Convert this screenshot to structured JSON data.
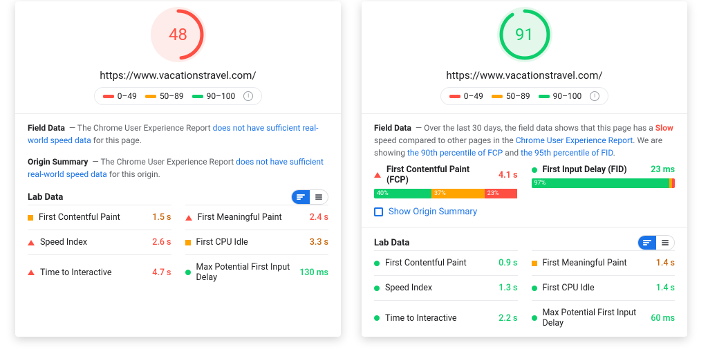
{
  "legend": {
    "r": "0–49",
    "o": "50–89",
    "g": "90–100"
  },
  "colors": {
    "red": "#ff4e42",
    "orange": "#ffa400",
    "green": "#0cce6b",
    "blue": "#1a73e8"
  },
  "left": {
    "score": 48,
    "score_pct": 48,
    "status": "bad",
    "url": "https://www.vacationstravel.com/",
    "fieldData": {
      "title": "Field Data",
      "text_pre": "— The Chrome User Experience Report ",
      "link": "does not have sufficient real-world speed data",
      "text_post": " for this page."
    },
    "originSummary": {
      "title": "Origin Summary",
      "text_pre": "— The Chrome User Experience Report ",
      "link": "does not have sufficient real-world speed data",
      "text_post": " for this origin."
    },
    "labTitle": "Lab Data",
    "metrics": [
      {
        "icon": "sq-orange",
        "label": "First Contentful Paint",
        "value": "1.5 s",
        "cls": "orange"
      },
      {
        "icon": "tri-red",
        "label": "First Meaningful Paint",
        "value": "2.4 s",
        "cls": "red"
      },
      {
        "icon": "tri-red",
        "label": "Speed Index",
        "value": "2.6 s",
        "cls": "red"
      },
      {
        "icon": "sq-orange",
        "label": "First CPU Idle",
        "value": "3.3 s",
        "cls": "orange"
      },
      {
        "icon": "tri-red",
        "label": "Time to Interactive",
        "value": "4.7 s",
        "cls": "red"
      },
      {
        "icon": "dot-green",
        "label": "Max Potential First Input Delay",
        "value": "130 ms",
        "cls": "green"
      }
    ]
  },
  "right": {
    "score": 91,
    "score_pct": 91,
    "status": "good",
    "url": "https://www.vacationstravel.com/",
    "fieldData": {
      "title": "Field Data",
      "text1": "— Over the last 30 days, the field data shows that this page has a ",
      "slow": "Slow",
      "text2": " speed compared to other pages in the ",
      "link1": "Chrome User Experience Report",
      "text3": ". We are showing ",
      "link2": "the 90th percentile of FCP",
      "text4": " and ",
      "link3": "the 95th percentile of FID",
      "text5": "."
    },
    "fcp": {
      "label": "First Contentful Paint (FCP)",
      "value": "4.1 s",
      "cls": "red",
      "dist": [
        {
          "p": 40,
          "l": "40%",
          "c": "g"
        },
        {
          "p": 37,
          "l": "37%",
          "c": "o"
        },
        {
          "p": 23,
          "l": "23%",
          "c": "r"
        }
      ]
    },
    "fid": {
      "label": "First Input Delay (FID)",
      "value": "23 ms",
      "cls": "green",
      "dist": [
        {
          "p": 97,
          "l": "97%",
          "c": "g"
        },
        {
          "p": 2,
          "l": "2%",
          "c": "o"
        },
        {
          "p": 1,
          "l": "1%",
          "c": "r"
        }
      ]
    },
    "showOrigin": "Show Origin Summary",
    "labTitle": "Lab Data",
    "metrics": [
      {
        "icon": "dot-green",
        "label": "First Contentful Paint",
        "value": "0.9 s",
        "cls": "green"
      },
      {
        "icon": "sq-orange",
        "label": "First Meaningful Paint",
        "value": "1.4 s",
        "cls": "orange"
      },
      {
        "icon": "dot-green",
        "label": "Speed Index",
        "value": "1.3 s",
        "cls": "green"
      },
      {
        "icon": "dot-green",
        "label": "First CPU Idle",
        "value": "1.4 s",
        "cls": "green"
      },
      {
        "icon": "dot-green",
        "label": "Time to Interactive",
        "value": "2.2 s",
        "cls": "green"
      },
      {
        "icon": "dot-green",
        "label": "Max Potential First Input Delay",
        "value": "60 ms",
        "cls": "green"
      }
    ]
  }
}
